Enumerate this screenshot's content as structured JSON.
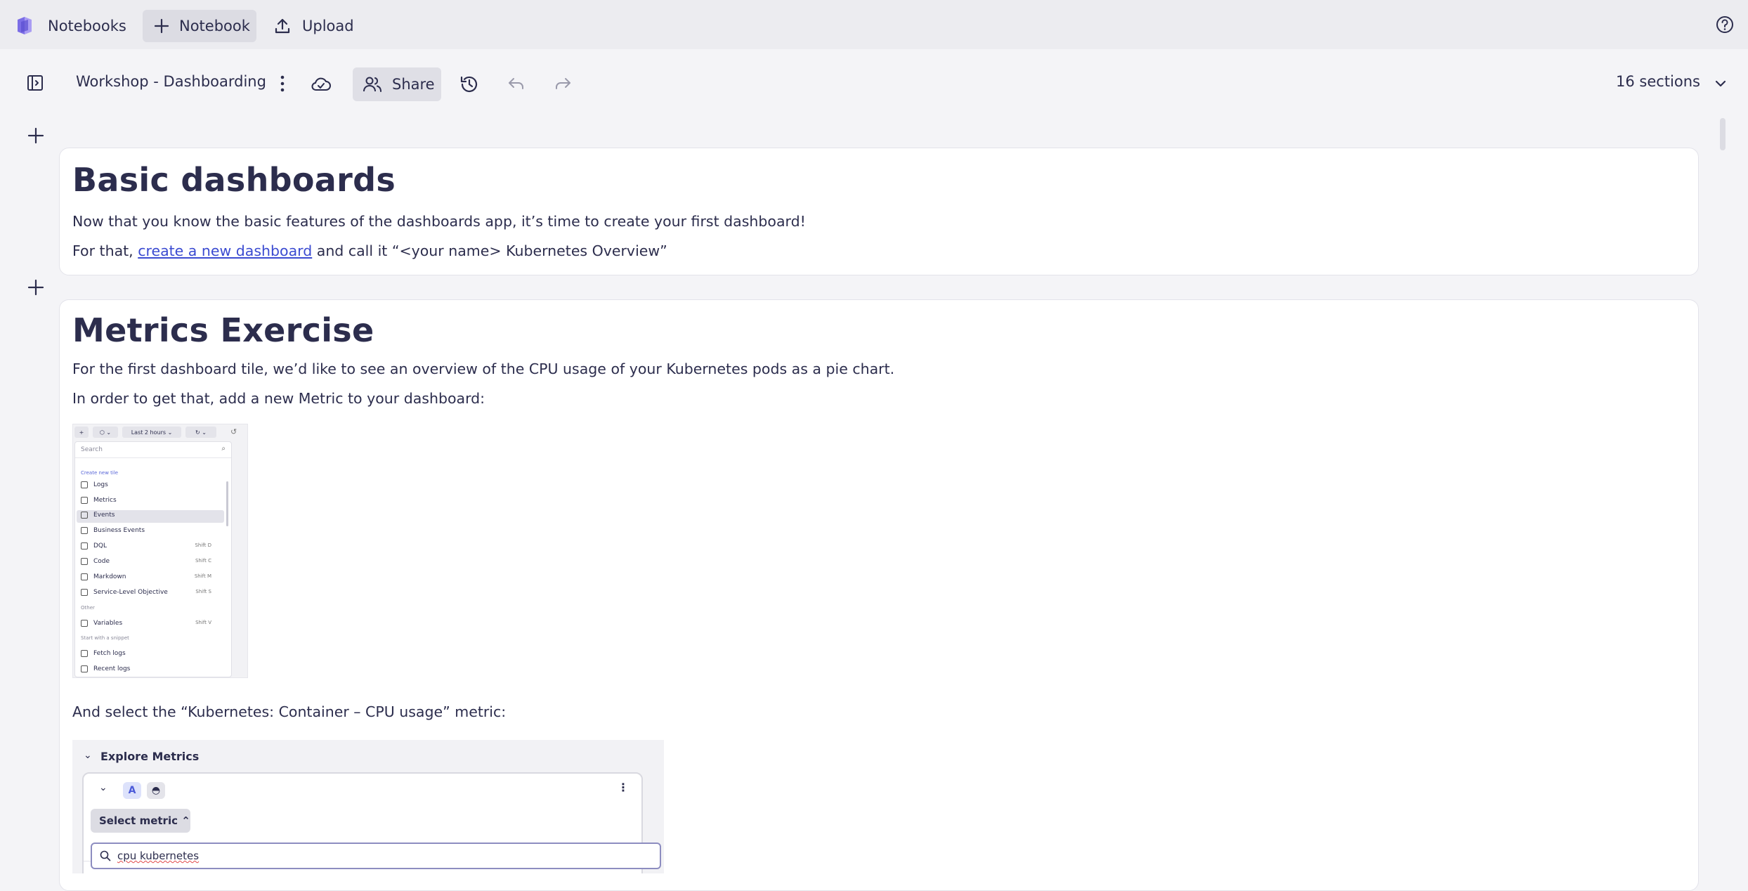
{
  "topbar": {
    "notebooks_label": "Notebooks",
    "new_notebook_label": "Notebook",
    "upload_label": "Upload"
  },
  "notebook": {
    "title": "Workshop - Dashboarding",
    "share_label": "Share",
    "sections_label": "16 sections"
  },
  "cards": {
    "basic": {
      "heading": "Basic dashboards",
      "p1": "Now that you know the basic features of the dashboards app, it’s time to create your first dashboard!",
      "p2_prefix": "For that, ",
      "p2_link": "create a new dashboard",
      "p2_suffix": " and call it “<your name> Kubernetes Overview”"
    },
    "metrics": {
      "heading": "Metrics Exercise",
      "p1": "For the first dashboard tile, we’d like to see an overview of the CPU usage of your Kubernetes pods as a pie chart.",
      "p2": "In order to get that, add a new Metric to your dashboard:",
      "p3": "And select the “Kubernetes: Container – CPU usage” metric:"
    }
  },
  "screenshot1": {
    "timeframe": "Last 2 hours",
    "search_placeholder": "Search",
    "create_header": "Create new tile",
    "items": [
      {
        "label": "Logs",
        "kbd": ""
      },
      {
        "label": "Metrics",
        "kbd": ""
      },
      {
        "label": "Events",
        "kbd": ""
      },
      {
        "label": "Business Events",
        "kbd": ""
      },
      {
        "label": "DQL",
        "kbd": "Shift D"
      },
      {
        "label": "Code",
        "kbd": "Shift C"
      },
      {
        "label": "Markdown",
        "kbd": "Shift M"
      },
      {
        "label": "Service-Level Objective",
        "kbd": "Shift S"
      }
    ],
    "other_header": "Other",
    "variables": {
      "label": "Variables",
      "kbd": "Shift V"
    },
    "snippet_header": "Start with a snippet",
    "snippets": [
      "Fetch logs",
      "Recent logs"
    ]
  },
  "screenshot2": {
    "title": "Explore Metrics",
    "badge": "A",
    "select_label": "Select metric",
    "search_value": "cpu kubernetes"
  }
}
